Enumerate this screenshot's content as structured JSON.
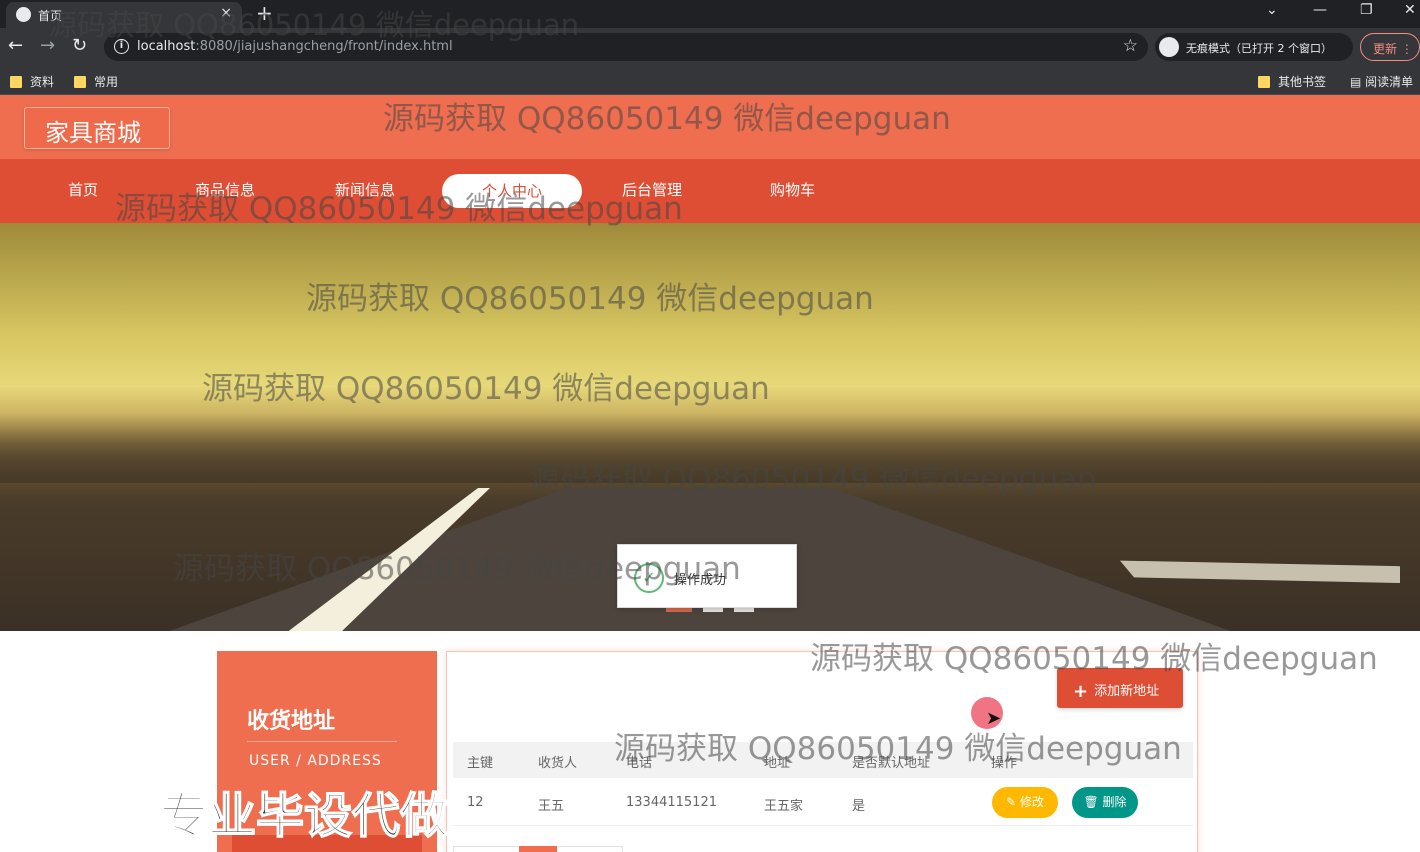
{
  "browser": {
    "tab_title": "首页",
    "tab_close": "×",
    "new_tab": "+",
    "url_host": "localhost",
    "url_path": ":8080/jiajushangcheng/front/index.html",
    "incognito_label": "无痕模式（已打开 2 个窗口）",
    "update_label": "更新",
    "bookmarks": [
      "资料",
      "常用"
    ],
    "bookmarks_right": [
      "其他书签",
      "阅读清单"
    ]
  },
  "site": {
    "logo": "家具商城",
    "nav": [
      "首页",
      "商品信息",
      "新闻信息",
      "个人中心",
      "后台管理",
      "购物车"
    ],
    "active_nav": "个人中心"
  },
  "toast": {
    "message": "操作成功"
  },
  "sidebar": {
    "title": "收货地址",
    "subtitle": "USER / ADDRESS"
  },
  "address": {
    "add_label": "添加新地址",
    "columns": [
      "主键",
      "收货人",
      "电话",
      "地址",
      "是否默认地址",
      "操作"
    ],
    "rows": [
      {
        "id": "12",
        "name": "王五",
        "phone": "13344115121",
        "addr": "王五家",
        "is_default": "是"
      }
    ],
    "edit_label": "修改",
    "delete_label": "删除"
  },
  "watermark": {
    "text": "源码获取 QQ86050149 微信deepguan",
    "big_text": "专业毕设代做"
  },
  "colors": {
    "primary": "#ef6e4f",
    "nav": "#de4e34",
    "edit": "#ffb800",
    "delete": "#009688"
  }
}
